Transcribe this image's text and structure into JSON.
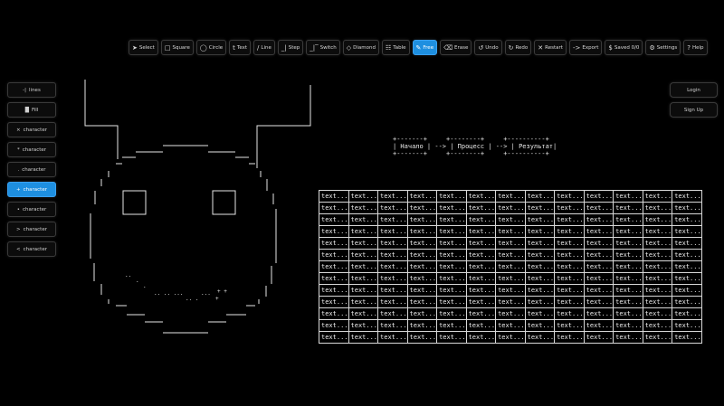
{
  "toolbar": {
    "tools": [
      {
        "icon": "➤",
        "label": "Select",
        "icon_name": "cursor-icon"
      },
      {
        "icon": "□",
        "label": "Square",
        "icon_name": "square-icon"
      },
      {
        "icon": "◯",
        "label": "Circle",
        "icon_name": "circle-icon"
      },
      {
        "icon": "t",
        "label": "Text",
        "icon_name": "text-icon"
      },
      {
        "icon": "/",
        "label": "Line",
        "icon_name": "line-icon"
      },
      {
        "icon": "_|",
        "label": "Step",
        "icon_name": "step-icon"
      },
      {
        "icon": "_|‾",
        "label": "Switch",
        "icon_name": "switch-icon"
      },
      {
        "icon": "◇",
        "label": "Diamond",
        "icon_name": "diamond-icon"
      },
      {
        "icon": "☷",
        "label": "Table",
        "icon_name": "table-icon"
      },
      {
        "icon": "✎",
        "label": "Free",
        "icon_name": "pencil-icon",
        "active": true
      },
      {
        "icon": "⌫",
        "label": "Erase",
        "icon_name": "eraser-icon"
      },
      {
        "icon": "↺",
        "label": "Undo",
        "icon_name": "undo-icon"
      },
      {
        "icon": "↻",
        "label": "Redo",
        "icon_name": "redo-icon"
      },
      {
        "icon": "✕",
        "label": "Restart",
        "icon_name": "restart-icon"
      },
      {
        "icon": "->",
        "label": "Export",
        "icon_name": "export-icon"
      },
      {
        "icon": "$",
        "label": "Saved 0/0",
        "icon_name": "dollar-icon"
      },
      {
        "icon": "⚙",
        "label": "Settings",
        "icon_name": "gear-icon"
      },
      {
        "icon": "?",
        "label": "Help",
        "icon_name": "help-icon"
      }
    ]
  },
  "left_panel": {
    "items": [
      {
        "icon": "-|",
        "label": "lines"
      },
      {
        "icon": "█",
        "label": "Fill"
      },
      {
        "icon": "×",
        "label": "character"
      },
      {
        "icon": "*",
        "label": "character"
      },
      {
        "icon": ".",
        "label": "character"
      },
      {
        "icon": "+",
        "label": "character",
        "active": true
      },
      {
        "icon": "•",
        "label": "character"
      },
      {
        "icon": ">",
        "label": "character"
      },
      {
        "icon": "<",
        "label": "character"
      }
    ]
  },
  "right_panel": {
    "login": "Login",
    "signup": "Sign Up"
  },
  "flow": {
    "top": "+-------+     +--------+     +----------+",
    "mid": "| Начало | --> | Процесс | --> | Результат|",
    "bot": "+-------+     +--------+     +----------+"
  },
  "grid": {
    "cell": "text...",
    "rows": 13,
    "cols": 13
  },
  "colors": {
    "background": "#000000",
    "accent": "#1e8fe0",
    "line": "#e6e6e6"
  }
}
